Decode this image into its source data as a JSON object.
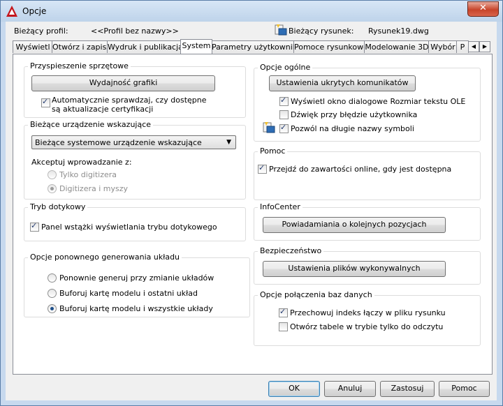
{
  "window": {
    "title": "Opcje",
    "close_label": "✕"
  },
  "profile": {
    "current_profile_label": "Bieżący profil:",
    "current_profile_value": "<<Profil bez nazwy>>",
    "current_drawing_label": "Bieżący rysunek:",
    "current_drawing_value": "Rysunek19.dwg"
  },
  "tabs": [
    {
      "label": "Wyświetl"
    },
    {
      "label": "Otwórz i zapisz"
    },
    {
      "label": "Wydruk i publikacja"
    },
    {
      "label": "System",
      "active": true
    },
    {
      "label": "Parametry użytkownika"
    },
    {
      "label": "Pomoce rysunkowe"
    },
    {
      "label": "Modelowanie 3D"
    },
    {
      "label": "Wybór"
    },
    {
      "label": "P"
    }
  ],
  "tab_scroll": {
    "left": "◀",
    "right": "▶"
  },
  "hw": {
    "title": "Przyspieszenie sprzętowe",
    "button": "Wydajność grafiki",
    "auto_check_line1": "Automatycznie sprawdzaj, czy dostępne",
    "auto_check_line2": "są aktualizacje certyfikacji",
    "auto_check_checked": true
  },
  "pointer": {
    "title": "Bieżące urządzenie wskazujące",
    "select_value": "Bieżące systemowe urządzenie wskazujące",
    "accept_label": "Akceptuj wprowadzanie z:",
    "opt_digitizer_only": "Tylko digitizera",
    "opt_digitizer_mouse": "Digitizera i myszy",
    "selected": "opt_digitizer_mouse"
  },
  "touch": {
    "title": "Tryb dotykowy",
    "checkbox": "Panel wstążki wyświetlania trybu dotykowego",
    "checked": true
  },
  "regen": {
    "title": "Opcje ponownego generowania układu",
    "opt1": "Ponownie generuj przy zmianie układów",
    "opt2": "Buforuj kartę modelu i ostatni układ",
    "opt3": "Buforuj kartę modelu i wszystkie układy",
    "selected": "opt3"
  },
  "general": {
    "title": "Opcje ogólne",
    "button": "Ustawienia ukrytych komunikatów",
    "cb1": "Wyświetl okno dialogowe Rozmiar tekstu OLE",
    "cb1_checked": true,
    "cb2": "Dźwięk przy błędzie użytkownika",
    "cb2_checked": false,
    "cb3": "Pozwól na długie nazwy symboli",
    "cb3_checked": true
  },
  "help": {
    "title": "Pomoc",
    "checkbox": "Przejdź do zawartości online, gdy jest dostępna",
    "checked": true
  },
  "infocenter": {
    "title": "InfoCenter",
    "button": "Powiadamiania o kolejnych pozycjach"
  },
  "security": {
    "title": "Bezpieczeństwo",
    "button": "Ustawienia plików wykonywalnych"
  },
  "db": {
    "title": "Opcje połączenia baz danych",
    "cb1": "Przechowuj indeks łączy w pliku rysunku",
    "cb1_checked": true,
    "cb2": "Otwórz tabele w trybie tylko do odczytu",
    "cb2_checked": false
  },
  "footer": {
    "ok": "OK",
    "cancel": "Anuluj",
    "apply": "Zastosuj",
    "help": "Pomoc"
  },
  "colors": {
    "title_bar": "#c7d9ee",
    "close_red": "#c7452b",
    "accent": "#3c7fb1"
  }
}
